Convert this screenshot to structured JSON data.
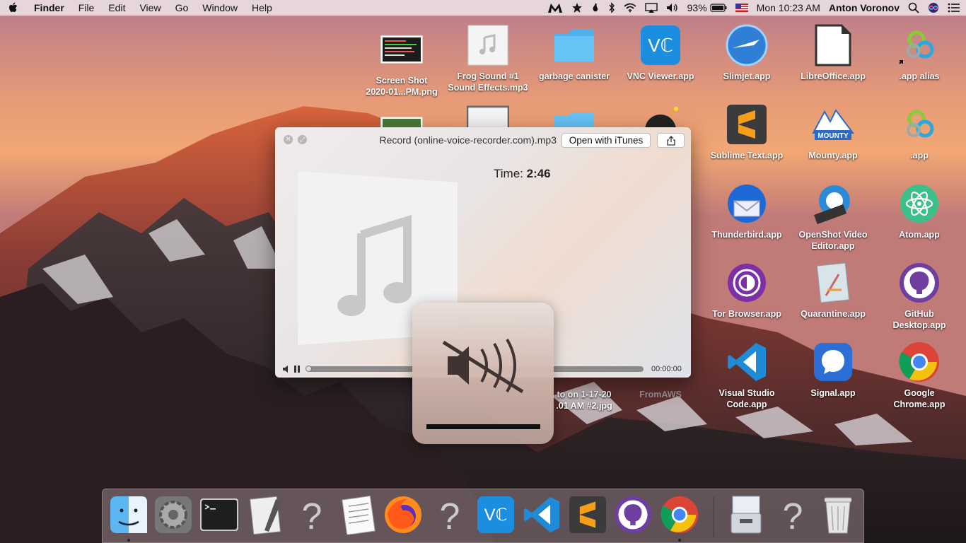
{
  "menubar": {
    "app_name": "Finder",
    "menus": [
      "File",
      "Edit",
      "View",
      "Go",
      "Window",
      "Help"
    ],
    "battery": "93%",
    "clock": "Mon 10:23 AM",
    "user": "Anton Voronov"
  },
  "desktop": {
    "icons": [
      {
        "label": "Screen Shot\n2020-01...PM.png",
        "icon": "screenshot-thumbnail"
      },
      {
        "label": "Frog Sound #1\nSound Effects.mp3",
        "icon": "audio-file-icon"
      },
      {
        "label": "garbage canister",
        "icon": "folder-icon"
      },
      {
        "label": "VNC Viewer.app",
        "icon": "vnc-viewer-icon"
      },
      {
        "label": "Slimjet.app",
        "icon": "slimjet-icon"
      },
      {
        "label": "LibreOffice.app",
        "icon": "libreoffice-icon"
      },
      {
        "label": ".app alias",
        "icon": "app-alias-icon"
      },
      {
        "label": "Sublime Text.app",
        "icon": "sublime-text-icon"
      },
      {
        "label": "Mounty.app",
        "icon": "mounty-icon"
      },
      {
        "label": ".app",
        "icon": "app-icon"
      },
      {
        "label": "Thunderbird.app",
        "icon": "thunderbird-icon"
      },
      {
        "label": "OpenShot Video\nEditor.app",
        "icon": "openshot-icon"
      },
      {
        "label": "Atom.app",
        "icon": "atom-icon"
      },
      {
        "label": "Tor Browser.app",
        "icon": "tor-browser-icon"
      },
      {
        "label": "Quarantine.app",
        "icon": "quarantine-icon"
      },
      {
        "label": "GitHub\nDesktop.app",
        "icon": "github-desktop-icon"
      },
      {
        "label": "Visual Studio\nCode.app",
        "icon": "vscode-icon"
      },
      {
        "label": "Signal.app",
        "icon": "signal-icon"
      },
      {
        "label": "Google\nChrome.app",
        "icon": "chrome-icon"
      },
      {
        "label": "FromAWS",
        "icon": "folder-icon"
      },
      {
        "label": "to on 1-17-20\n.01 AM #2.jpg",
        "icon": "image-file-icon"
      }
    ]
  },
  "quicklook": {
    "filename": "Record (online-voice-recorder.com).mp3",
    "open_button": "Open with iTunes",
    "time_label": "Time:",
    "time_value": "2:46",
    "elapsed": "00:00:00",
    "progress": 0
  },
  "volume_hud": {
    "muted": true,
    "level": 0
  },
  "dock": {
    "items": [
      "Finder",
      "System Preferences",
      "Terminal",
      "Script Editor",
      "Unknown",
      "TextEdit",
      "Firefox",
      "Unknown",
      "VNC Viewer",
      "Visual Studio Code",
      "Sublime Text",
      "GitHub Desktop",
      "Google Chrome",
      "Downloads",
      "Unknown",
      "Trash"
    ]
  },
  "colors": {
    "accent_blue": "#1c8ee0",
    "folder_blue": "#5ab8f0"
  }
}
